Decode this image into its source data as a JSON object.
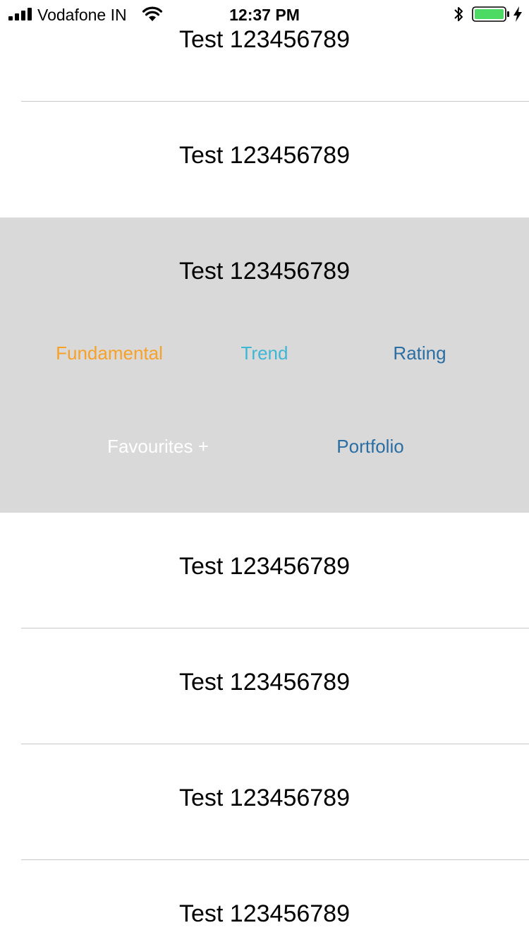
{
  "status_bar": {
    "carrier": "Vodafone IN",
    "time": "12:37 PM",
    "battery_color": "#4cd964",
    "icons": [
      "signal-bars-icon",
      "wifi-icon",
      "bluetooth-icon",
      "battery-icon",
      "charging-bolt-icon"
    ]
  },
  "list": {
    "rows": [
      {
        "label": "Test 123456789"
      },
      {
        "label": "Test 123456789"
      },
      {
        "label": "Test 123456789"
      },
      {
        "label": "Test 123456789"
      },
      {
        "label": "Test 123456789"
      },
      {
        "label": "Test 123456789"
      },
      {
        "label": "Test 123456789"
      }
    ],
    "expanded_row": {
      "background": "#d9d9d9",
      "actions": [
        {
          "label": "Fundamental",
          "color": "#f7a128"
        },
        {
          "label": "Trend",
          "color": "#3fb6d3"
        },
        {
          "label": "Rating",
          "color": "#2a6ea3"
        },
        {
          "label": "Favourites +",
          "color": "#ffffff"
        },
        {
          "label": "Portfolio",
          "color": "#2a6ea3"
        }
      ]
    }
  }
}
